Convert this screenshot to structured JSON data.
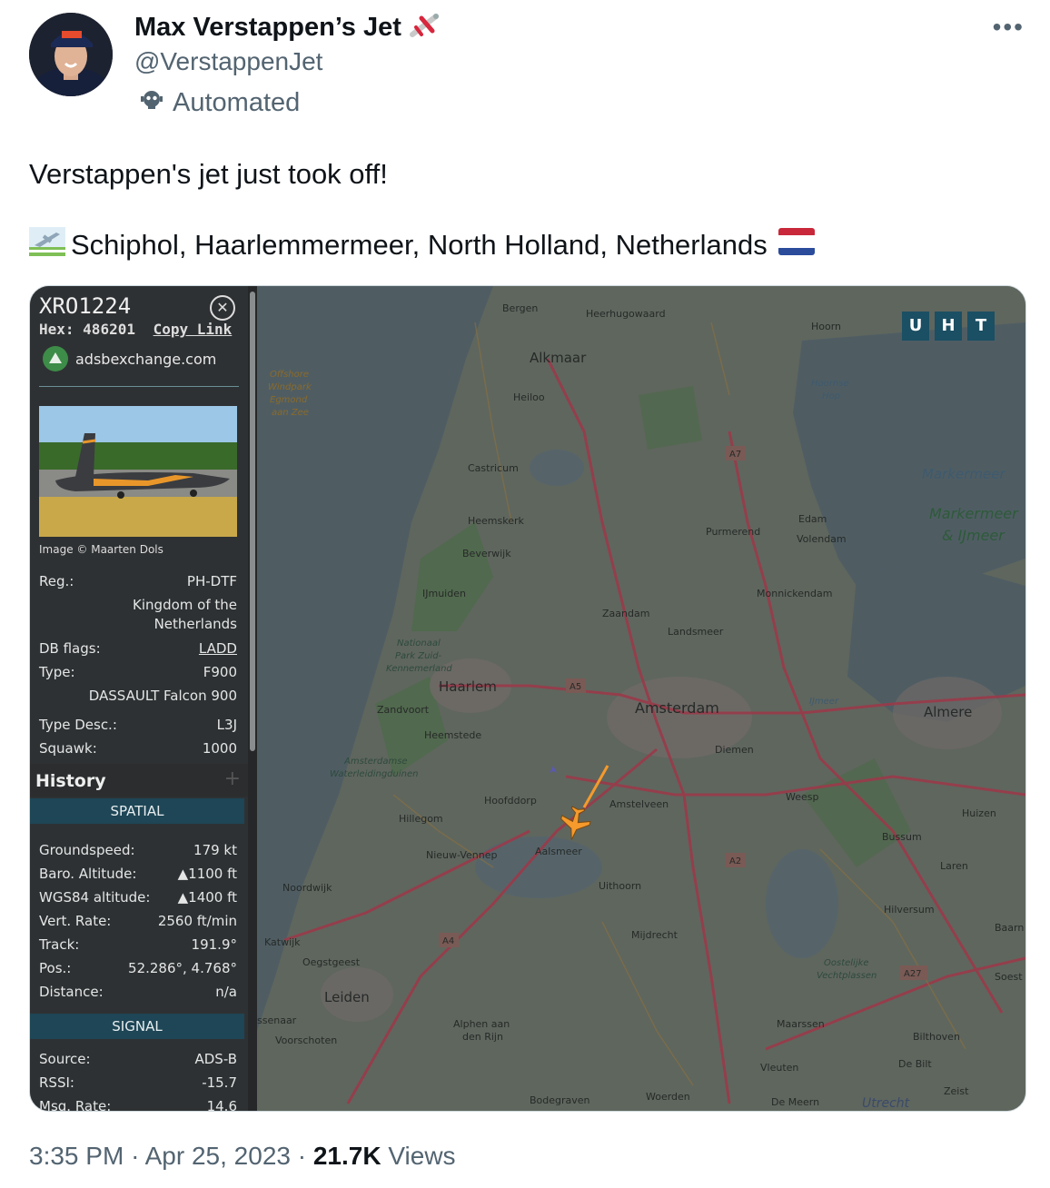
{
  "tweet": {
    "author_name": "Max Verstappen’s Jet",
    "handle": "@VerstappenJet",
    "automated_label": "Automated",
    "text_line1": "Verstappen's jet just took off!",
    "location_line": "Schiphol, Haarlemmermeer, North Holland, Netherlands",
    "time": "3:35 PM",
    "date": "Apr 25, 2023",
    "views_count": "21.7K",
    "views_label": "Views",
    "separator": "·"
  },
  "panel": {
    "callsign": "XRO1224",
    "hex_label": "Hex:",
    "hex_value": "486201",
    "copy_link": "Copy Link",
    "site": "adsbexchange.com",
    "image_credit": "Image © Maarten Dols",
    "reg_label": "Reg.:",
    "reg_value": "PH-DTF",
    "country_line1": "Kingdom of the",
    "country_line2": "Netherlands",
    "db_flags_label": "DB flags:",
    "db_flags_value": "LADD",
    "type_label": "Type:",
    "type_value": "F900",
    "type_full": "DASSAULT Falcon 900",
    "type_desc_label": "Type Desc.:",
    "type_desc_value": "L3J",
    "squawk_label": "Squawk:",
    "squawk_value": "1000",
    "history_label": "History",
    "history_plus": "+",
    "spatial_label": "SPATIAL",
    "groundspeed_label": "Groundspeed:",
    "groundspeed_value": "179 kt",
    "baro_label": "Baro. Altitude:",
    "baro_value": "▲1100 ft",
    "wgs_label": "WGS84 altitude:",
    "wgs_value": "▲1400 ft",
    "vert_label": "Vert. Rate:",
    "vert_value": "2560 ft/min",
    "track_label": "Track:",
    "track_value": "191.9°",
    "pos_label": "Pos.:",
    "pos_value": "52.286°, 4.768°",
    "distance_label": "Distance:",
    "distance_value": "n/a",
    "signal_label": "SIGNAL",
    "source_label": "Source:",
    "source_value": "ADS-B",
    "rssi_label": "RSSI:",
    "rssi_value": "-15.7",
    "msg_label": "Msg. Rate:",
    "msg_value": "14.6"
  },
  "map_buttons": [
    "U",
    "H",
    "T"
  ],
  "map_labels": {
    "alkmaar": "Alkmaar",
    "heerhugowaard": "Heerhugowaard",
    "hoorn": "Hoorn",
    "heiloo": "Heiloo",
    "castricum": "Castricum",
    "heemskerk": "Heemskerk",
    "beverwijk": "Beverwijk",
    "ijmuiden": "IJmuiden",
    "zaandam": "Zaandam",
    "landsmeer": "Landsmeer",
    "purmerend": "Purmerend",
    "edam": "Edam",
    "volendam": "Volendam",
    "monnickendam": "Monnickendam",
    "haarlem": "Haarlem",
    "amsterdam": "Amsterdam",
    "zandvoort": "Zandvoort",
    "heemstede": "Heemstede",
    "diemen": "Diemen",
    "almere": "Almere",
    "hoofddorp": "Hoofddorp",
    "amstelveen": "Amstelveen",
    "weesp": "Weesp",
    "hillegom": "Hillegom",
    "aalsmeer": "Aalsmeer",
    "nieuw_vennep": "Nieuw-Vennep",
    "uithoorn": "Uithoorn",
    "bussum": "Bussum",
    "huizen": "Huizen",
    "laren": "Laren",
    "noordwijk": "Noordwijk",
    "hilversum": "Hilversum",
    "katwijk": "Katwijk",
    "mijdrecht": "Mijdrecht",
    "oegstgeest": "Oegstgeest",
    "leiden": "Leiden",
    "voorschoten": "Voorschoten",
    "alphen": "Alphen aan",
    "alphen2": "den Rijn",
    "maarssen": "Maarssen",
    "bilthoven": "Bilthoven",
    "de_bilt": "De Bilt",
    "vleuten": "Vleuten",
    "de_meern": "De Meern",
    "utrecht": "Utrecht",
    "zeist": "Zeist",
    "bodegraven": "Bodegraven",
    "woerden": "Woerden",
    "soest": "Soest",
    "baarn": "Baarn",
    "markermeer": "Markermeer",
    "markermeer_ij": "Markermeer",
    "markermeer_ij2": "& IJmeer",
    "ijmeer": "IJmeer",
    "hoornse": "Hoornse",
    "hop": "Hop",
    "offshore1": "Offshore",
    "offshore2": "Windpark",
    "offshore3": "Egmond",
    "offshore4": "aan Zee",
    "np1": "Nationaal",
    "np2": "Park Zuid-",
    "np3": "Kennemerland",
    "awd1": "Amsterdamse",
    "awd2": "Waterleidingduinen",
    "ov1": "Oostelijke",
    "ov2": "Vechtplassen",
    "a7": "A7",
    "a5": "A5",
    "a2": "A2",
    "a4": "A4",
    "a27": "A27",
    "bergen": "Bergen",
    "wassenaar": "ssenaar",
    "np_e": "Na",
    "np_p": "P",
    "np_u": "Ut",
    "oo": "Oo"
  },
  "colors": {
    "panel_bg": "#2e3133",
    "section_bg": "#1e4656",
    "map_land": "#5f665e",
    "map_water": "#4f5d63",
    "aircraft": "#f59a2c",
    "route_red": "#9a3a4a"
  },
  "icons": [
    "avatar",
    "airplane-emoji-icon",
    "robot-icon",
    "more-icon",
    "airport-emoji-icon",
    "netherlands-flag-icon",
    "close-icon",
    "adsb-logo-icon",
    "aircraft-icon"
  ]
}
